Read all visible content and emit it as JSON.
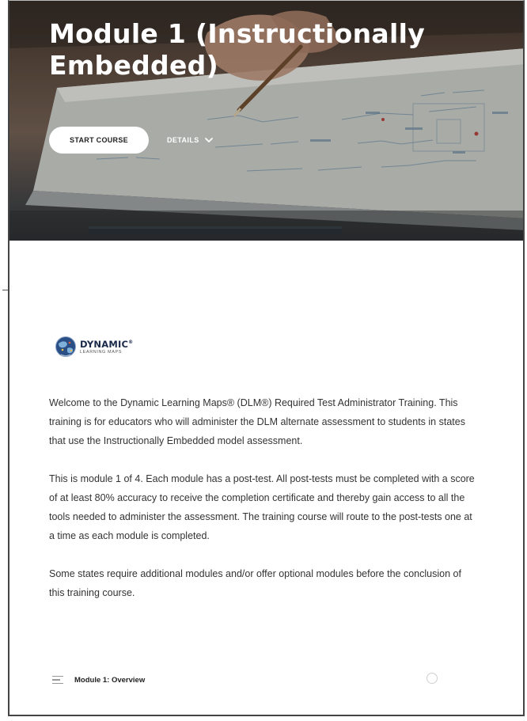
{
  "hero": {
    "title": "Module 1 (Instructionally Embedded)",
    "start_button": "START COURSE",
    "details_button": "DETAILS"
  },
  "logo": {
    "main_text": "DYNAMIC",
    "registered_mark": "®",
    "sub_text": "LEARNING MAPS"
  },
  "description": {
    "paragraphs": [
      "Welcome to the Dynamic Learning Maps® (DLM®) Required Test Administrator Training. This training is for educators who will administer the DLM alternate assessment to students in states that use the Instructionally Embedded model assessment.",
      "This is module 1 of 4. Each module has a post-test. All post-tests must be completed with a score of at least 80% accuracy to receive the completion certificate and thereby gain access to all the tools needed to administer the assessment. The training course will route to the post-tests one at a time as each module is completed.",
      "Some states require additional modules and/or offer optional modules before the conclusion of this training course."
    ]
  },
  "lessons": [
    {
      "label": "Module 1: Overview",
      "status": "not-started"
    }
  ],
  "colors": {
    "button_bg": "#ffffff",
    "title_text": "#ffffff",
    "body_text": "#333333",
    "logo_navy": "#1b2a4a"
  }
}
